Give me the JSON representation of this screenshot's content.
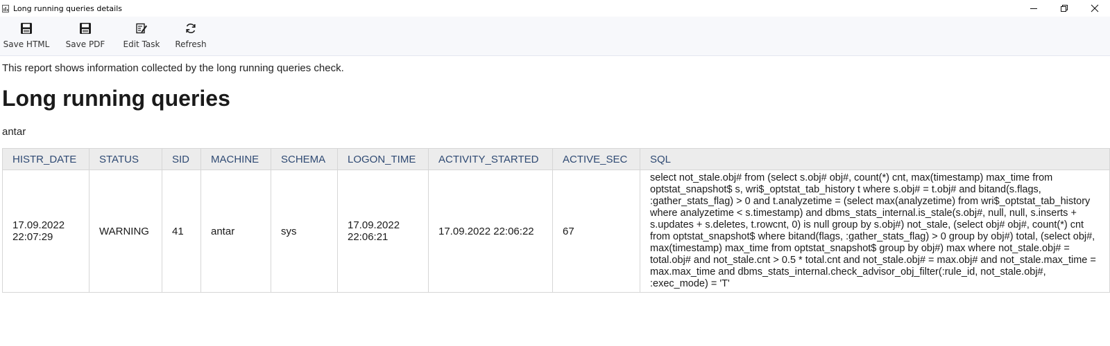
{
  "window": {
    "title": "Long running queries details",
    "icons": {
      "app": "report-icon",
      "minimize": "minimize-icon",
      "restore": "restore-icon",
      "close": "close-icon"
    }
  },
  "toolbar": {
    "buttons": [
      {
        "label": "Save HTML",
        "icon": "floppy-disk-icon"
      },
      {
        "label": "Save PDF",
        "icon": "floppy-disk-icon"
      },
      {
        "label": "Edit Task",
        "icon": "edit-icon"
      },
      {
        "label": "Refresh",
        "icon": "refresh-icon"
      }
    ]
  },
  "report": {
    "intro": "This report shows information collected by the long running queries check.",
    "heading": "Long running queries",
    "host": "antar",
    "columns": [
      "HISTR_DATE",
      "STATUS",
      "SID",
      "MACHINE",
      "SCHEMA",
      "LOGON_TIME",
      "ACTIVITY_STARTED",
      "ACTIVE_SEC",
      "SQL"
    ],
    "rows": [
      {
        "histr_date": "17.09.2022 22:07:29",
        "status": "WARNING",
        "sid": "41",
        "machine": "antar",
        "schema": "sys",
        "logon_time": "17.09.2022 22:06:21",
        "activity_started": "17.09.2022 22:06:22",
        "active_sec": "67",
        "sql": "select not_stale.obj# from (select s.obj# obj#, count(*) cnt, max(timestamp) max_time from optstat_snapshot$ s, wri$_optstat_tab_history t where s.obj# = t.obj# and bitand(s.flags, :gather_stats_flag) > 0 and t.analyzetime = (select max(analyzetime) from wri$_optstat_tab_history where analyzetime < s.timestamp) and dbms_stats_internal.is_stale(s.obj#, null, null, s.inserts + s.updates + s.deletes, t.rowcnt, 0) is null group by s.obj#) not_stale, (select obj# obj#, count(*) cnt from optstat_snapshot$ where bitand(flags, :gather_stats_flag) > 0 group by obj#) total, (select obj#, max(timestamp) max_time from optstat_snapshot$ group by obj#) max where not_stale.obj# = total.obj# and not_stale.cnt > 0.5 * total.cnt and not_stale.obj# = max.obj# and not_stale.max_time = max.max_time and dbms_stats_internal.check_advisor_obj_filter(:rule_id, not_stale.obj#, :exec_mode) = 'T'"
      }
    ]
  },
  "colors": {
    "toolbar_bg": "#f7f8fb",
    "header_bg": "#ececec",
    "header_text": "#2f4a73",
    "border": "#d6d6d6"
  }
}
